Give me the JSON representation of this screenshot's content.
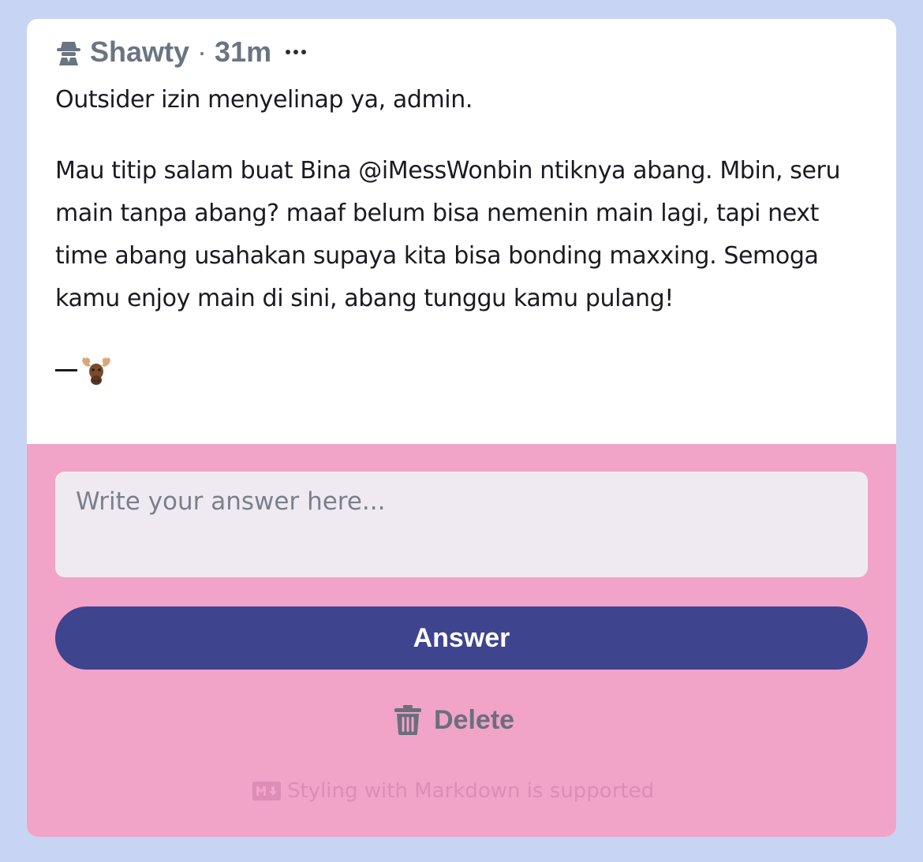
{
  "question": {
    "author": "Shawty",
    "separator": "·",
    "time_ago": "31m",
    "author_icon": "spy-icon",
    "more_icon": "more-horizontal-icon",
    "paragraphs": [
      "Outsider izin menyelinap ya, admin.",
      "Mau titip salam buat Bina @iMessWonbin ntiknya abang. Mbin, seru main tanpa abang? maaf belum bisa nemenin main lagi, tapi next time abang usahakan supaya kita bisa bonding maxxing. Semoga kamu enjoy main di sini, abang tunggu kamu pulang!"
    ],
    "signature_dash": "—",
    "signature_emoji": "moose-emoji"
  },
  "answer": {
    "placeholder": "Write your answer here...",
    "value": "",
    "submit_label": "Answer",
    "delete_label": "Delete",
    "delete_icon": "trash-icon",
    "markdown_note": "Styling with Markdown is supported",
    "markdown_icon": "markdown-icon"
  },
  "colors": {
    "page_background": "#c8d4f4",
    "card_background": "#ffffff",
    "answer_area_background": "#f1a3c8",
    "input_background": "#efeaf1",
    "answer_button": "#3e448e",
    "muted_text": "#6b7582"
  }
}
